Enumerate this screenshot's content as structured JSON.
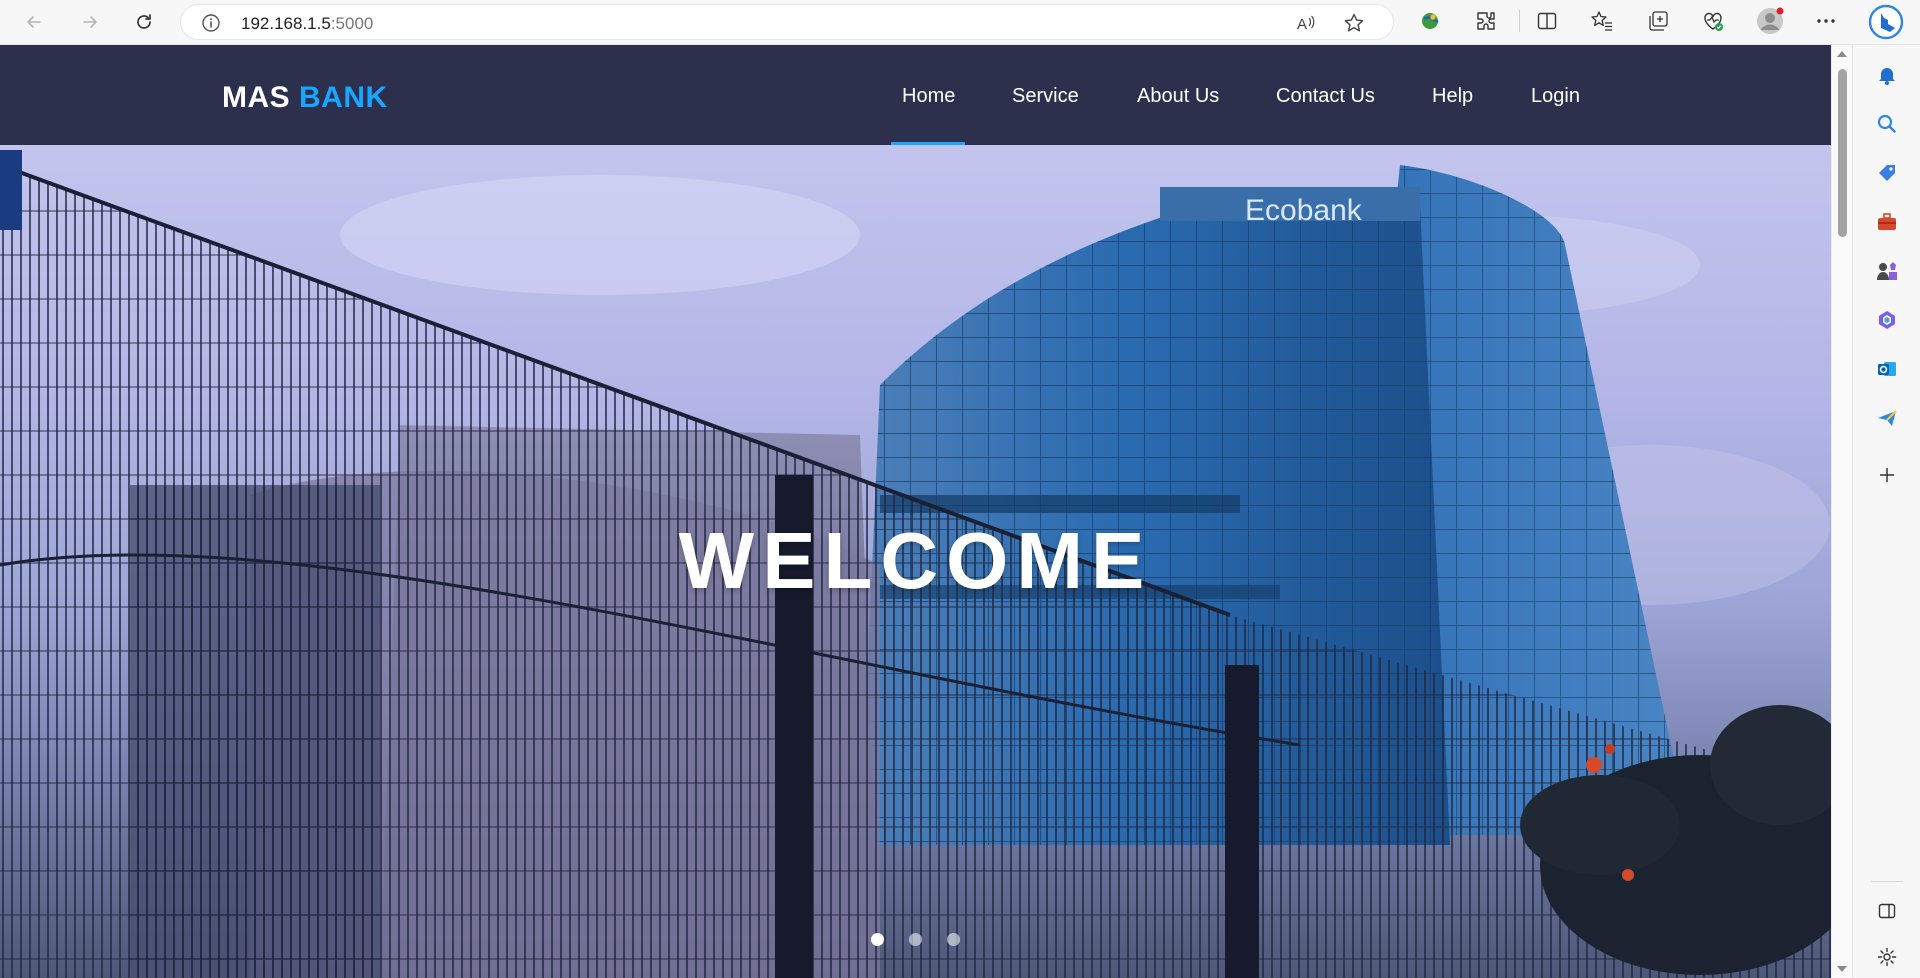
{
  "browser": {
    "url_host": "192.168.1.5",
    "url_port": ":5000"
  },
  "site": {
    "logo_primary": "MAS",
    "logo_accent": "BANK",
    "nav": [
      {
        "label": "Home",
        "active": true
      },
      {
        "label": "Service"
      },
      {
        "label": "About Us"
      },
      {
        "label": "Contact Us"
      },
      {
        "label": "Help"
      },
      {
        "label": "Login"
      }
    ]
  },
  "hero": {
    "headline": "WELCOME",
    "building_sign": "Ecobank",
    "slides_total": 3,
    "active_slide": 1
  },
  "colors": {
    "header_bg": "#2d304d",
    "accent": "#19a6ff"
  },
  "icons": {
    "toolbar": [
      "collections-globe-icon",
      "extensions-icon",
      "split-screen-icon",
      "favorites-icon",
      "collections-icon",
      "browser-essentials-icon",
      "profile-avatar",
      "more-options-icon",
      "copilot-icon"
    ],
    "sidebar": [
      "notifications-bell-icon",
      "search-icon",
      "shopping-tag-icon",
      "tools-briefcase-icon",
      "games-icon",
      "microsoft365-icon",
      "outlook-icon",
      "send-icon",
      "add-icon",
      "sidebar-toggle-icon",
      "settings-gear-icon"
    ]
  }
}
